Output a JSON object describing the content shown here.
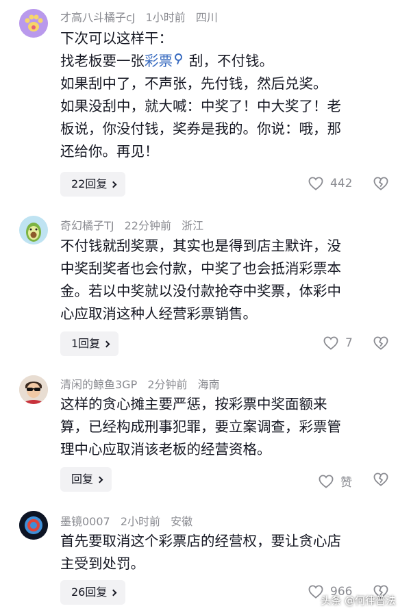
{
  "comments": [
    {
      "username": "才高八斗橘子cJ",
      "time": "1小时前",
      "location": "四川",
      "lines": [
        "下次可以这样干：",
        "",
        "如果刮中了，不声张，先付钱，然后兑奖。",
        "如果没刮中，就大喊：中奖了！中大奖了！老",
        "板说，你没付钱，奖券是我的。你说：哦，那",
        "还给你。再见！"
      ],
      "line2_prefix": "找老板要一张",
      "line2_link": "彩票",
      "line2_suffix": "刮，不付钱。",
      "reply_label": "22回复",
      "likes": "442"
    },
    {
      "username": "奇幻橘子TJ",
      "time": "22分钟前",
      "location": "浙江",
      "lines": [
        "不付钱就刮奖票，其实也是得到店主默许，没",
        "中奖刮奖者也会付款，中奖了也会抵消彩票本",
        "金。若以中奖就以没付款抢夺中奖票，体彩中",
        "心应取消这种人经营彩票销售。"
      ],
      "reply_label": "1回复",
      "likes": "7"
    },
    {
      "username": "清闲的鲸鱼3GP",
      "time": "2分钟前",
      "location": "海南",
      "lines": [
        "这样的贪心摊主要严惩，按彩票中奖面额来",
        "算，已经构成刑事犯罪，要立案调查，彩票管",
        "理中心应取消该老板的经营资格。"
      ],
      "reply_label": "回复",
      "likes": "赞"
    },
    {
      "username": "墨镜0007",
      "time": "2小时前",
      "location": "安徽",
      "lines": [
        "首先要取消这个彩票店的经营权，要让贪心店",
        "主受到处罚。"
      ],
      "reply_label": "26回复",
      "likes": "966"
    }
  ],
  "watermark": "头条 @何律普法",
  "colors": {
    "link": "#3a6cc0",
    "meta": "#8a8b91",
    "reply_bg": "#f2f2f4"
  }
}
